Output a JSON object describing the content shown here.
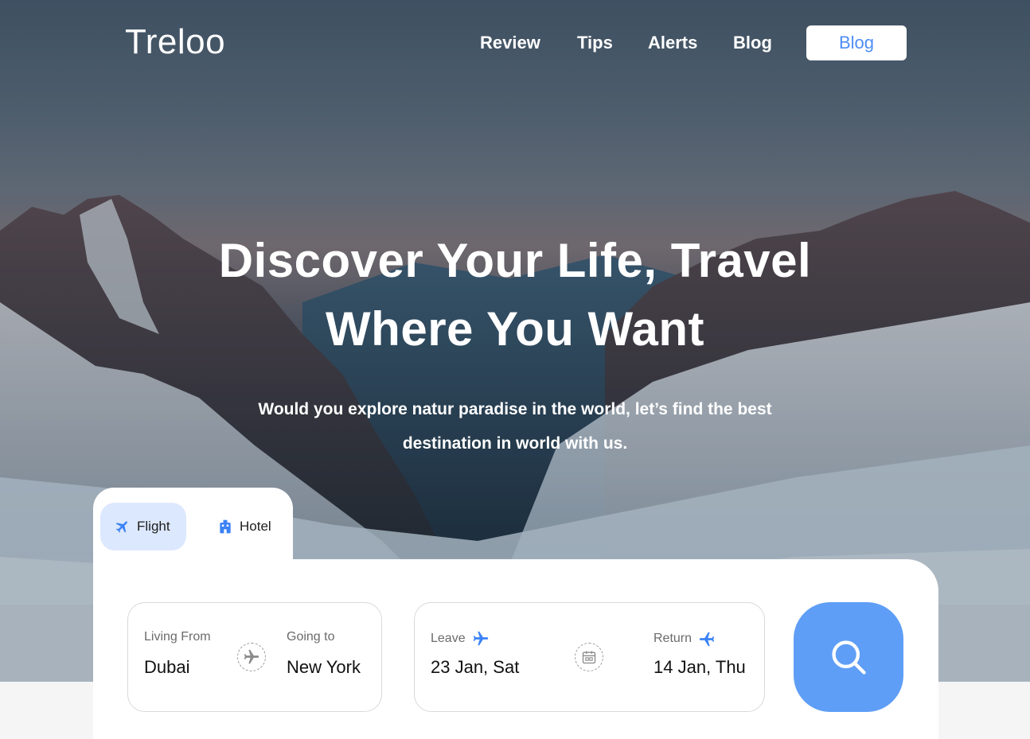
{
  "brand": {
    "logo": "Treloo"
  },
  "nav": {
    "links": [
      "Review",
      "Tips",
      "Alerts",
      "Blog"
    ],
    "cta_label": "Blog"
  },
  "hero": {
    "headline_line1": "Discover Your Life, Travel",
    "headline_line2": "Where You Want",
    "subtitle_line1": "Would you explore natur paradise in the world, let’s find the best",
    "subtitle_line2": "destination in world with us."
  },
  "tabs": [
    {
      "label": "Flight",
      "icon": "airplane-icon",
      "active": true
    },
    {
      "label": "Hotel",
      "icon": "hotel-icon",
      "active": false
    }
  ],
  "search": {
    "from_label": "Living From",
    "from_value": "Dubai",
    "to_label": "Going to",
    "to_value": "New York",
    "leave_label": "Leave",
    "leave_value": "23 Jan, Sat",
    "return_label": "Return",
    "return_value": "14 Jan, Thu"
  },
  "colors": {
    "accent": "#4e8df5",
    "search_button": "#5f9ef6",
    "active_tab_bg": "#dce8fd"
  }
}
